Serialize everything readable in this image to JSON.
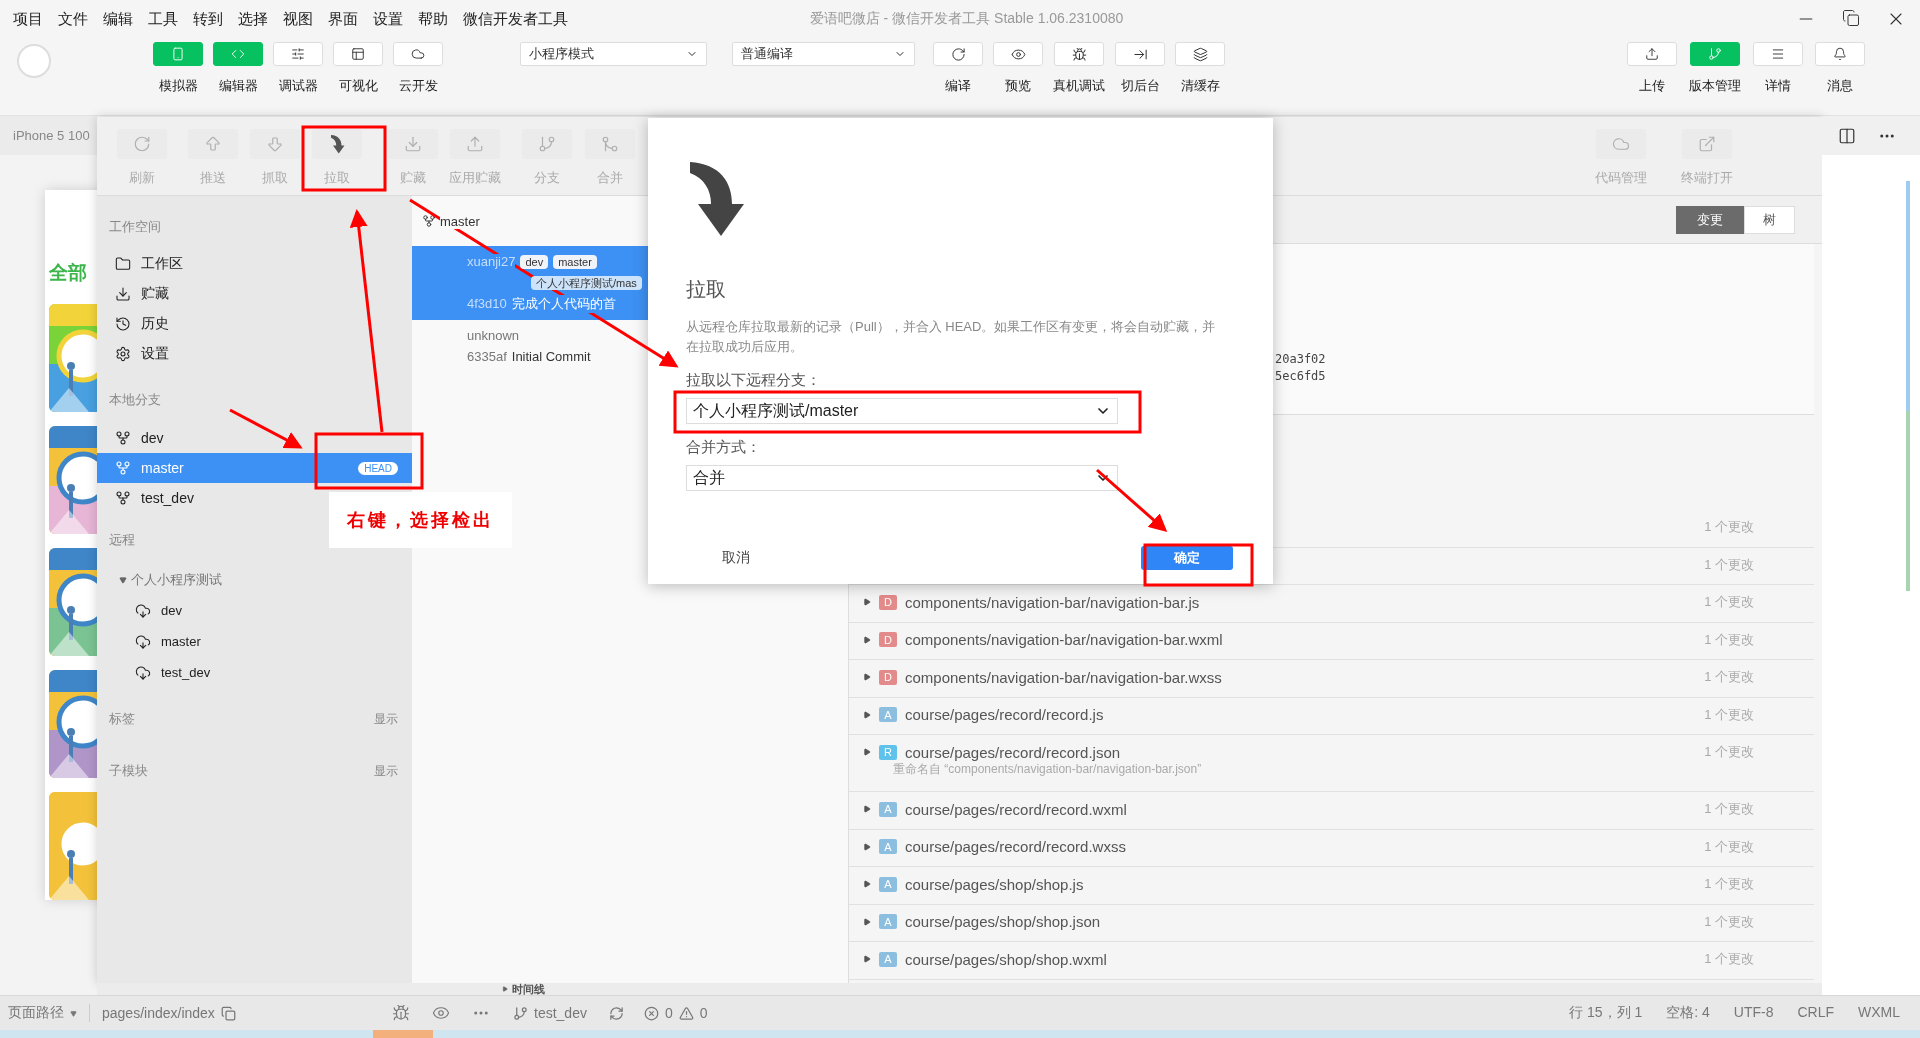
{
  "menu_bar": {
    "items": [
      "项目",
      "文件",
      "编辑",
      "工具",
      "转到",
      "选择",
      "视图",
      "界面",
      "设置",
      "帮助",
      "微信开发者工具"
    ],
    "title": "爱语吧微店 - 微信开发者工具 Stable 1.06.2310080"
  },
  "toolbar": {
    "left_tools": [
      {
        "label": "模拟器",
        "active": true
      },
      {
        "label": "编辑器",
        "active": true
      },
      {
        "label": "调试器",
        "active": false
      },
      {
        "label": "可视化",
        "active": false
      },
      {
        "label": "云开发",
        "active": false
      }
    ],
    "mode_select": "小程序模式",
    "compile_select": "普通编译",
    "center_tools": [
      {
        "label": "编译"
      },
      {
        "label": "预览"
      },
      {
        "label": "真机调试"
      },
      {
        "label": "切后台"
      },
      {
        "label": "清缓存"
      }
    ],
    "right_tools": [
      {
        "label": "上传",
        "active": false
      },
      {
        "label": "版本管理",
        "active": true
      },
      {
        "label": "详情",
        "active": false
      },
      {
        "label": "消息",
        "active": false
      }
    ]
  },
  "simulator": {
    "device": "iPhone 5 100",
    "tab": "全部"
  },
  "git": {
    "tools": [
      {
        "label": "刷新",
        "active": false
      },
      {
        "label": "推送",
        "active": false
      },
      {
        "label": "抓取",
        "active": false
      },
      {
        "label": "拉取",
        "active": true
      },
      {
        "label": "贮藏",
        "active": false
      },
      {
        "label": "应用贮藏",
        "active": false
      },
      {
        "label": "分支",
        "active": false
      },
      {
        "label": "合并",
        "active": false
      }
    ],
    "right_tools": [
      {
        "label": "代码管理"
      },
      {
        "label": "终端打开"
      }
    ],
    "sidebar": {
      "workspace": {
        "title": "工作空间",
        "items": [
          {
            "label": "工作区"
          },
          {
            "label": "贮藏"
          },
          {
            "label": "历史"
          },
          {
            "label": "设置"
          }
        ]
      },
      "local_branches": {
        "title": "本地分支",
        "items": [
          {
            "label": "dev",
            "selected": false
          },
          {
            "label": "master",
            "selected": true,
            "badge": "HEAD"
          },
          {
            "label": "test_dev",
            "selected": false
          }
        ]
      },
      "remotes": {
        "title": "远程",
        "tree": [
          {
            "label": "个人小程序测试",
            "expanded": true,
            "children": [
              {
                "label": "dev"
              },
              {
                "label": "master"
              },
              {
                "label": "test_dev"
              }
            ]
          }
        ]
      },
      "extra_sections": [
        {
          "title": "标签",
          "action": "显示"
        },
        {
          "title": "子模块",
          "action": "显示"
        }
      ]
    },
    "commit_list": {
      "branch": "master",
      "commits": [
        {
          "author": "xuanji27",
          "tags": [
            {
              "label": "dev",
              "kind": "local"
            },
            {
              "label": "master",
              "kind": "local"
            },
            {
              "label": "个人小程序测试/mas",
              "kind": "remote"
            }
          ],
          "hash": "4f3d10",
          "message": "完成个人代码的首",
          "selected": true
        },
        {
          "author": "unknown",
          "hash": "6335af",
          "message": "Initial Commit",
          "selected": false
        }
      ]
    },
    "view_toggle": [
      {
        "label": "变更",
        "selected": true
      },
      {
        "label": "树",
        "selected": false
      }
    ],
    "detail_fragments": [
      "20a3f02",
      "5ec6fd5"
    ],
    "files": [
      {
        "changes": "1 个更改"
      },
      {
        "changes": "1 个更改"
      },
      {
        "status": "D",
        "path": "components/navigation-bar/navigation-bar.js",
        "changes": "1 个更改"
      },
      {
        "status": "D",
        "path": "components/navigation-bar/navigation-bar.wxml",
        "changes": "1 个更改"
      },
      {
        "status": "D",
        "path": "components/navigation-bar/navigation-bar.wxss",
        "changes": "1 个更改"
      },
      {
        "status": "A",
        "path": "course/pages/record/record.js",
        "changes": "1 个更改"
      },
      {
        "status": "R",
        "path": "course/pages/record/record.json",
        "changes": "1 个更改",
        "note": "重命名自 “components/navigation-bar/navigation-bar.json”"
      },
      {
        "status": "A",
        "path": "course/pages/record/record.wxml",
        "changes": "1 个更改"
      },
      {
        "status": "A",
        "path": "course/pages/record/record.wxss",
        "changes": "1 个更改"
      },
      {
        "status": "A",
        "path": "course/pages/shop/shop.js",
        "changes": "1 个更改"
      },
      {
        "status": "A",
        "path": "course/pages/shop/shop.json",
        "changes": "1 个更改"
      },
      {
        "status": "A",
        "path": "course/pages/shop/shop.wxml",
        "changes": "1 个更改"
      }
    ]
  },
  "timeline": "时间线",
  "status_bar": {
    "path_label": "页面路径",
    "path": "pages/index/index",
    "branch": "test_dev",
    "errors": "0",
    "warnings": "0",
    "position": "行 15，列 1",
    "indent": "空格: 4",
    "encoding": "UTF-8",
    "eol": "CRLF",
    "language": "WXML"
  },
  "dialog": {
    "title": "拉取",
    "description": "从远程仓库拉取最新的记录（Pull），并合入 HEAD。如果工作区有变更，将会自动贮藏，并在拉取成功后应用。",
    "branch_label": "拉取以下远程分支：",
    "branch_value": "个人小程序测试/master",
    "merge_label": "合并方式：",
    "merge_value": "合并",
    "cancel": "取消",
    "confirm": "确定"
  },
  "annotation": {
    "note": "右键，选择检出"
  }
}
